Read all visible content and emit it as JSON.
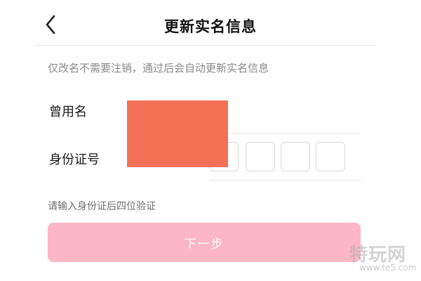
{
  "header": {
    "title": "更新实名信息",
    "back_icon": "chevron-left-icon"
  },
  "hint": "仅改名不需要注销，通过后会自动更新实名信息",
  "form": {
    "former_name_label": "曾用名",
    "id_number_label": "身份证号",
    "id_digit_boxes": [
      "",
      "",
      "",
      ""
    ]
  },
  "verify_hint": "请输入身份证后四位验证",
  "next_button": {
    "label": "下一步",
    "color": "#fcb6c6",
    "enabled": false
  },
  "redaction_color": "#f47157",
  "watermark": {
    "main": "特玩网",
    "sub": "www.te5.com"
  }
}
